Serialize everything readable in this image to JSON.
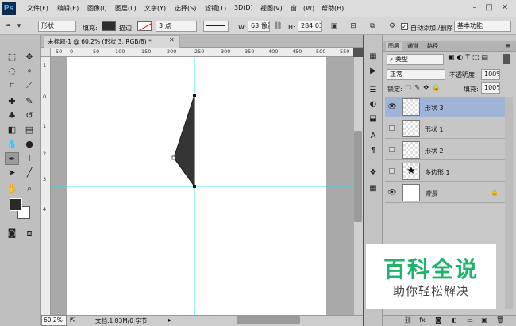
{
  "app": {
    "logo": "Ps"
  },
  "menu": [
    "文件(F)",
    "编辑(E)",
    "图像(I)",
    "图层(L)",
    "文字(Y)",
    "选择(S)",
    "滤镜(T)",
    "3D(D)",
    "视图(V)",
    "窗口(W)",
    "帮助(H)"
  ],
  "options": {
    "mode": "形状",
    "fill_label": "填充:",
    "stroke_label": "描边:",
    "stroke_size": "3 点",
    "w_label": "W:",
    "w_value": "63 像素",
    "h_label": "H:",
    "h_value": "284.03",
    "auto_add": "自动添加 /删除",
    "workspace": "基本功能"
  },
  "document": {
    "tab_title": "未标题-1 @ 60.2% (形状 3, RGB/8) *",
    "zoom": "60.2%",
    "info": "文档:1.83M/0 字节",
    "ruler_top": [
      "50",
      "0",
      "50",
      "100",
      "150",
      "200",
      "250",
      "300",
      "350",
      "400",
      "450",
      "500",
      "550"
    ],
    "ruler_left": [
      "1",
      "0",
      "1",
      "2",
      "3",
      "4"
    ]
  },
  "layers_panel": {
    "tabs": [
      "图层",
      "通道",
      "路径"
    ],
    "filter": "类型",
    "blend_mode": "正常",
    "opacity_label": "不透明度:",
    "opacity": "100%",
    "lock_label": "锁定:",
    "fill_label": "填充:",
    "fill": "100%",
    "layers": [
      {
        "name": "形状 3",
        "visible": true,
        "selected": true
      },
      {
        "name": "形状 1",
        "visible": false,
        "selected": false
      },
      {
        "name": "形状 2",
        "visible": false,
        "selected": false
      },
      {
        "name": "多边形 1",
        "visible": false,
        "selected": false
      },
      {
        "name": "背景",
        "visible": true,
        "selected": false
      }
    ]
  },
  "watermark": {
    "title": "百科全说",
    "subtitle": "助你轻松解决"
  },
  "colors": {
    "accent": "#1fb46c",
    "selected_layer": "#9fb4d6",
    "guide": "#00e5ff"
  }
}
